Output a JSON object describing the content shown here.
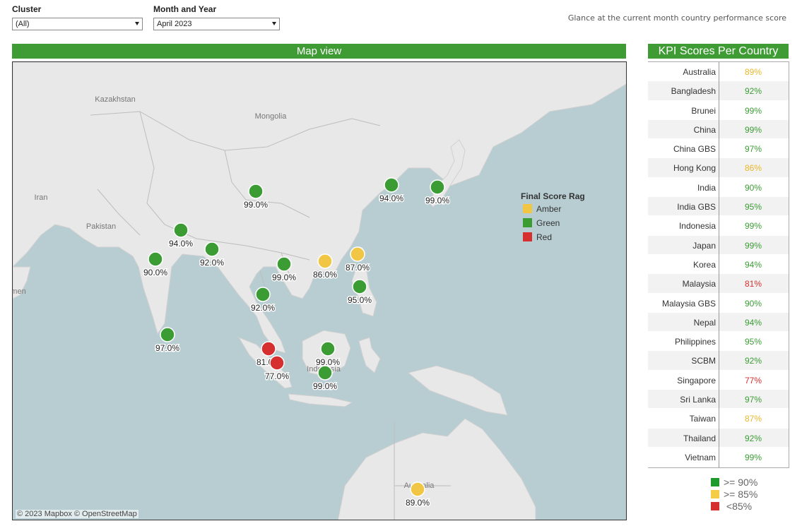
{
  "filters": {
    "cluster": {
      "label": "Cluster",
      "value": "(All)"
    },
    "month_year": {
      "label": "Month and Year",
      "value": "April 2023"
    }
  },
  "glance_text": "Glance at the current month country performance score",
  "map": {
    "title": "Map view",
    "attribution": "© 2023 Mapbox  © OpenStreetMap",
    "place_labels": [
      {
        "text": "Kazakhstan",
        "name": "kazakhstan"
      },
      {
        "text": "Mongolia",
        "name": "mongolia"
      },
      {
        "text": "Iran",
        "name": "iran"
      },
      {
        "text": "Pakistan",
        "name": "pakistan"
      },
      {
        "text": "men",
        "name": "yemen"
      },
      {
        "text": "Indonesia",
        "name": "indonesia"
      },
      {
        "text": "Australia",
        "name": "australia"
      }
    ],
    "legend": {
      "title": "Final Score Rag",
      "items": [
        {
          "label": "Amber",
          "color": "#f1c644"
        },
        {
          "label": "Green",
          "color": "#3a9c33"
        },
        {
          "label": "Red",
          "color": "#d62f2f"
        }
      ]
    },
    "points": [
      {
        "label": "99.0%",
        "rag": "green"
      },
      {
        "label": "94.0%",
        "rag": "green"
      },
      {
        "label": "99.0%",
        "rag": "green"
      },
      {
        "label": "94.0%",
        "rag": "green"
      },
      {
        "label": "92.0%",
        "rag": "green"
      },
      {
        "label": "90.0%",
        "rag": "green"
      },
      {
        "label": "99.0%",
        "rag": "green"
      },
      {
        "label": "86.0%",
        "rag": "amber"
      },
      {
        "label": "87.0%",
        "rag": "amber"
      },
      {
        "label": "92.0%",
        "rag": "green"
      },
      {
        "label": "95.0%",
        "rag": "green"
      },
      {
        "label": "97.0%",
        "rag": "green"
      },
      {
        "label": "81.0%",
        "rag": "red"
      },
      {
        "label": "77.0%",
        "rag": "red"
      },
      {
        "label": "99.0%",
        "rag": "green"
      },
      {
        "label": "99.0%",
        "rag": "green"
      },
      {
        "label": "89.0%",
        "rag": "amber"
      }
    ]
  },
  "kpi": {
    "title": "KPI Scores Per Country",
    "rows": [
      {
        "country": "Australia",
        "score": "89%",
        "rag": "amber"
      },
      {
        "country": "Bangladesh",
        "score": "92%",
        "rag": "green"
      },
      {
        "country": "Brunei",
        "score": "99%",
        "rag": "green"
      },
      {
        "country": "China",
        "score": "99%",
        "rag": "green"
      },
      {
        "country": "China GBS",
        "score": "97%",
        "rag": "green"
      },
      {
        "country": "Hong Kong",
        "score": "86%",
        "rag": "amber"
      },
      {
        "country": "India",
        "score": "90%",
        "rag": "green"
      },
      {
        "country": "India GBS",
        "score": "95%",
        "rag": "green"
      },
      {
        "country": "Indonesia",
        "score": "99%",
        "rag": "green"
      },
      {
        "country": "Japan",
        "score": "99%",
        "rag": "green"
      },
      {
        "country": "Korea",
        "score": "94%",
        "rag": "green"
      },
      {
        "country": "Malaysia",
        "score": "81%",
        "rag": "red"
      },
      {
        "country": "Malaysia GBS",
        "score": "90%",
        "rag": "green"
      },
      {
        "country": "Nepal",
        "score": "94%",
        "rag": "green"
      },
      {
        "country": "Philippines",
        "score": "95%",
        "rag": "green"
      },
      {
        "country": "SCBM",
        "score": "92%",
        "rag": "green"
      },
      {
        "country": "Singapore",
        "score": "77%",
        "rag": "red"
      },
      {
        "country": "Sri Lanka",
        "score": "97%",
        "rag": "green"
      },
      {
        "country": "Taiwan",
        "score": "87%",
        "rag": "amber"
      },
      {
        "country": "Thailand",
        "score": "92%",
        "rag": "green"
      },
      {
        "country": "Vietnam",
        "score": "99%",
        "rag": "green"
      }
    ],
    "threshold_legend": [
      {
        "label": ">= 90%",
        "color": "#1f9a2c"
      },
      {
        "label": ">= 85%",
        "color": "#f5cc45"
      },
      {
        "label": "<85%",
        "color": "#d62f2f"
      }
    ]
  },
  "colors": {
    "green": "#3a9c33",
    "amber": "#f1c644",
    "red": "#d62f2f",
    "text_green": "#3a9c33",
    "text_amber": "#e8b729",
    "text_red": "#d62f2f",
    "header_bar": "#3f9c35"
  }
}
